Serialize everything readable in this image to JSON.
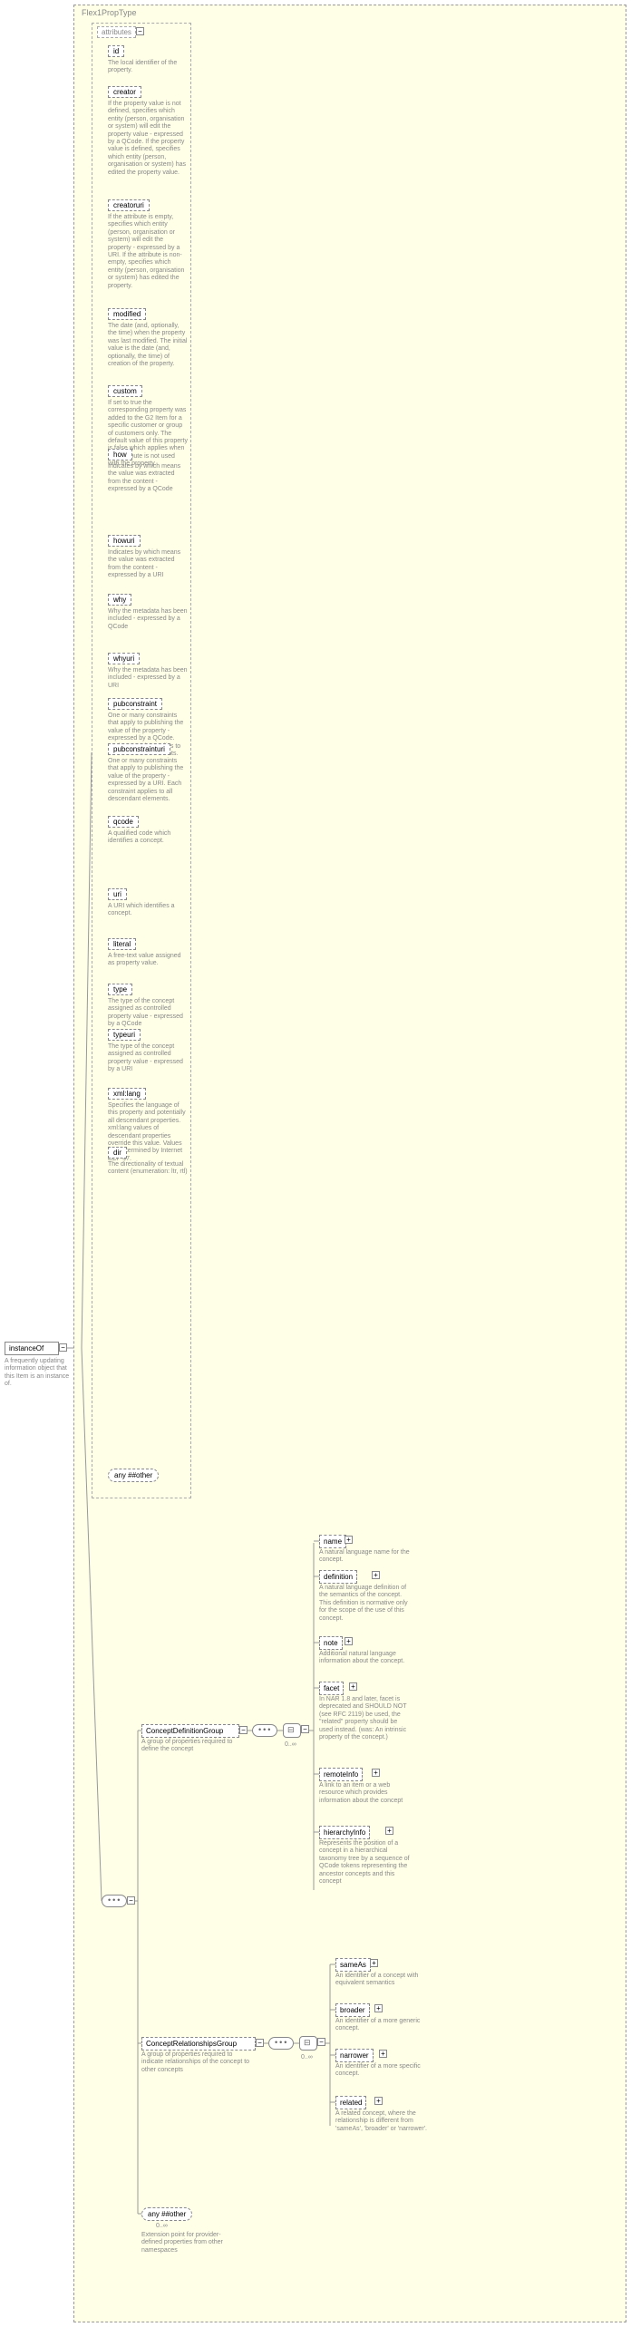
{
  "root": {
    "type_label": "Flex1PropType",
    "name": "instanceOf",
    "desc": "A frequently updating information object that this Item is an instance of."
  },
  "attributes_label": "attributes",
  "attributes": [
    {
      "name": "id",
      "desc": "The local identifier of the property."
    },
    {
      "name": "creator",
      "desc": "If the property value is not defined, specifies which entity (person, organisation or system) will edit the property value - expressed by a QCode. If the property value is defined, specifies which entity (person, organisation or system) has edited the property value."
    },
    {
      "name": "creatoruri",
      "desc": "If the attribute is empty, specifies which entity (person, organisation or system) will edit the property - expressed by a URI. If the attribute is non-empty, specifies which entity (person, organisation or system) has edited the property."
    },
    {
      "name": "modified",
      "desc": "The date (and, optionally, the time) when the property was last modified. The initial value is the date (and, optionally, the time) of creation of the property."
    },
    {
      "name": "custom",
      "desc": "If set to true the corresponding property was added to the G2 Item for a specific customer or group of customers only. The default value of this property is false which applies when this attribute is not used with the property."
    },
    {
      "name": "how",
      "desc": "Indicates by which means the value was extracted from the content - expressed by a QCode"
    },
    {
      "name": "howuri",
      "desc": "Indicates by which means the value was extracted from the content - expressed by a URI"
    },
    {
      "name": "why",
      "desc": "Why the metadata has been included - expressed by a QCode"
    },
    {
      "name": "whyuri",
      "desc": "Why the metadata has been included - expressed by a URI"
    },
    {
      "name": "pubconstraint",
      "desc": "One or many constraints that apply to publishing the value of the property - expressed by a QCode. Each constraint applies to all descendant elements."
    },
    {
      "name": "pubconstrainturi",
      "desc": "One or many constraints that apply to publishing the value of the property - expressed by a URI. Each constraint applies to all descendant elements."
    },
    {
      "name": "qcode",
      "desc": "A qualified code which identifies a concept."
    },
    {
      "name": "uri",
      "desc": "A URI which identifies a concept."
    },
    {
      "name": "literal",
      "desc": "A free-text value assigned as property value."
    },
    {
      "name": "type",
      "desc": "The type of the concept assigned as controlled property value - expressed by a QCode"
    },
    {
      "name": "typeuri",
      "desc": "The type of the concept assigned as controlled property value - expressed by a URI"
    },
    {
      "name": "xml:lang",
      "desc": "Specifies the language of this property and potentially all descendant properties. xml:lang values of descendant properties override this value. Values are determined by Internet BCP 47."
    },
    {
      "name": "dir",
      "desc": "The directionality of textual content (enumeration: ltr, rtl)"
    }
  ],
  "any_attr": "any ##other",
  "groups": {
    "def": {
      "name": "ConceptDefinitionGroup",
      "desc": "A group of properties required to define the concept"
    },
    "rel": {
      "name": "ConceptRelationshipsGroup",
      "desc": "A group of properties required to indicate relationships of the concept to other concepts"
    }
  },
  "def_children": [
    {
      "name": "name",
      "desc": "A natural language name for the concept."
    },
    {
      "name": "definition",
      "desc": "A natural language definition of the semantics of the concept. This definition is normative only for the scope of the use of this concept."
    },
    {
      "name": "note",
      "desc": "Additional natural language information about the concept."
    },
    {
      "name": "facet",
      "desc": "In NAR 1.8 and later, facet is deprecated and SHOULD NOT (see RFC 2119) be used, the \"related\" property should be used instead. (was: An intrinsic property of the concept.)"
    },
    {
      "name": "remoteInfo",
      "desc": "A link to an item or a web resource which provides information about the concept"
    },
    {
      "name": "hierarchyInfo",
      "desc": "Represents the position of a concept in a hierarchical taxonomy tree by a sequence of QCode tokens representing the ancestor concepts and this concept"
    }
  ],
  "rel_children": [
    {
      "name": "sameAs",
      "desc": "An identifier of a concept with equivalent semantics"
    },
    {
      "name": "broader",
      "desc": "An identifier of a more generic concept."
    },
    {
      "name": "narrower",
      "desc": "An identifier of a more specific concept."
    },
    {
      "name": "related",
      "desc": "A related concept, where the relationship is different from 'sameAs', 'broader' or 'narrower'."
    }
  ],
  "any_elem": {
    "label": "any ##other",
    "card": "0..∞",
    "desc": "Extension point for provider-defined properties from other namespaces"
  },
  "card": "0..∞"
}
